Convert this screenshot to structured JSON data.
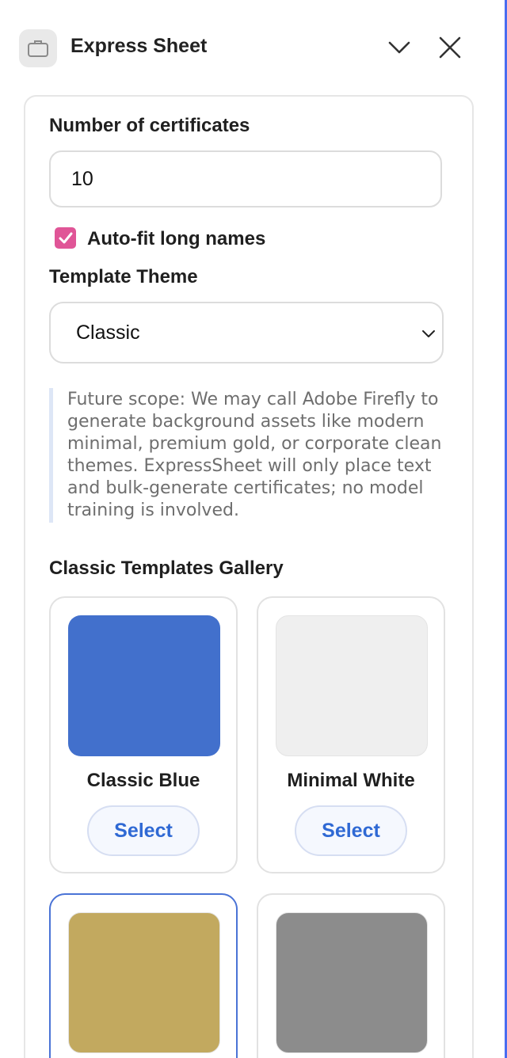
{
  "header": {
    "title": "Express Sheet",
    "app_icon": "briefcase-icon",
    "collapse_icon": "chevron-down-icon",
    "close_icon": "close-icon"
  },
  "form": {
    "count_label": "Number of certificates",
    "count_value": "10",
    "autofit_label": "Auto-fit long names",
    "autofit_checked": true,
    "theme_label": "Template Theme",
    "theme_value": "Classic",
    "note": "Future scope: We may call Adobe Firefly to generate background assets like modern minimal, premium gold, or corporate clean themes. ExpressSheet will only place text and bulk-generate certificates; no model training is involved."
  },
  "gallery": {
    "title": "Classic Templates Gallery",
    "select_label": "Select",
    "templates": [
      {
        "name": "Classic Blue",
        "color": "#4270cc"
      },
      {
        "name": "Minimal White",
        "color": "#efefef"
      },
      {
        "name": "",
        "color": "#c2a95f",
        "selected": true
      },
      {
        "name": "",
        "color": "#8c8c8c"
      }
    ]
  },
  "colors": {
    "accent": "#2f69d4",
    "checkbox": "#e05597",
    "edge": "#4a6cf0"
  }
}
